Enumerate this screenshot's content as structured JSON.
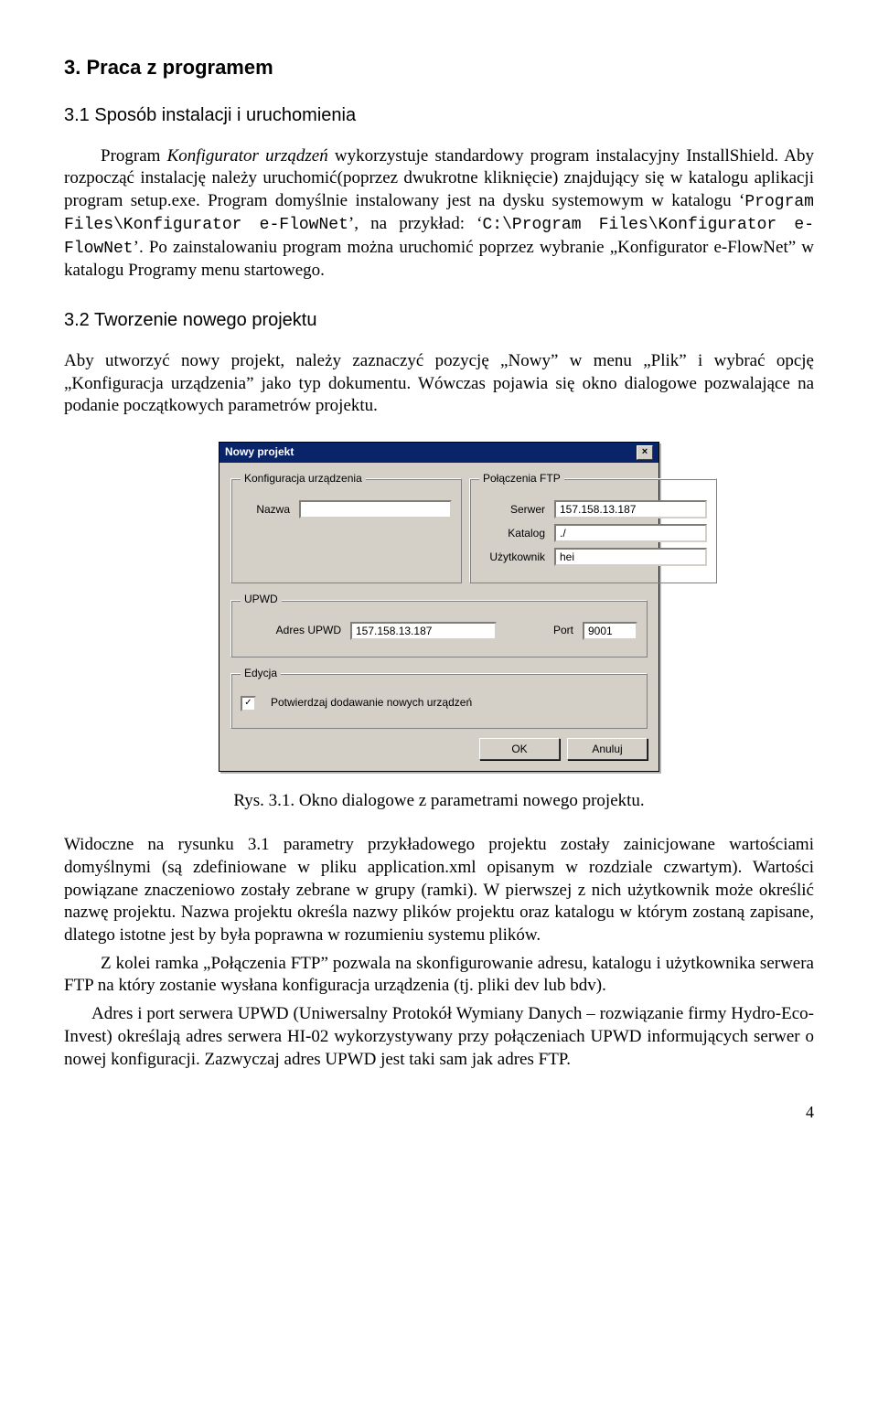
{
  "headings": {
    "h1": "3.  Praca z programem",
    "h2a": "3.1 Sposób instalacji i uruchomienia",
    "h2b": "3.2 Tworzenie nowego projektu"
  },
  "para": {
    "p1_a": "Program ",
    "p1_b": "Konfigurator urządzeń",
    "p1_c": " wykorzystuje standardowy program instalacyjny InstallShield. Aby rozpocząć instalację należy uruchomić(poprzez dwukrotne kliknięcie) znajdujący się w katalogu aplikacji program setup.exe. Program domyślnie instalowany jest na dysku systemowym w katalogu ‘",
    "p1_d": "Program Files\\Konfigurator e-FlowNet",
    "p1_e": "’, na przykład: ‘",
    "p1_f": "C:\\Program Files\\Konfigurator e-FlowNet",
    "p1_g": "’. Po zainstalowaniu program można uruchomić poprzez wybranie „Konfigurator e-FlowNet” w katalogu Programy menu startowego.",
    "p2": "Aby utworzyć nowy projekt, należy zaznaczyć pozycję „Nowy” w menu „Plik” i wybrać opcję „Konfiguracja urządzenia” jako typ dokumentu. Wówczas pojawia się okno dialogowe pozwalające na podanie początkowych parametrów projektu.",
    "caption": "Rys. 3.1. Okno dialogowe z parametrami nowego projektu.",
    "p3": "Widoczne na rysunku 3.1 parametry przykładowego projektu  zostały zainicjowane wartościami domyślnymi (są zdefiniowane w pliku application.xml opisanym w rozdziale czwartym). Wartości powiązane znaczeniowo zostały zebrane w grupy (ramki). W pierwszej z nich użytkownik może określić nazwę projektu. Nazwa projektu określa nazwy plików projektu oraz katalogu w którym zostaną zapisane, dlatego istotne jest by była poprawna w rozumieniu systemu plików.",
    "p4": "Z kolei ramka „Połączenia FTP” pozwala na skonfigurowanie adresu, katalogu i użytkownika serwera FTP na który zostanie wysłana konfiguracja urządzenia (tj. pliki dev lub bdv).",
    "p5": "Adres i port serwera UPWD (Uniwersalny Protokół Wymiany Danych – rozwiązanie firmy Hydro-Eco-Invest) określają adres serwera HI-02 wykorzystywany przy połączeniach UPWD informujących serwer o nowej konfiguracji. Zazwyczaj adres UPWD jest taki sam jak adres FTP."
  },
  "dialog": {
    "title": "Nowy projekt",
    "close_glyph": "×",
    "groups": {
      "config": {
        "legend": "Konfiguracja urządzenia",
        "name_label": "Nazwa",
        "name_value": ""
      },
      "ftp": {
        "legend": "Połączenia FTP",
        "server_label": "Serwer",
        "server_value": "157.158.13.187",
        "catalog_label": "Katalog",
        "catalog_value": "./",
        "user_label": "Użytkownik",
        "user_value": "hei"
      },
      "upwd": {
        "legend": "UPWD",
        "addr_label": "Adres UPWD",
        "addr_value": "157.158.13.187",
        "port_label": "Port",
        "port_value": "9001"
      },
      "edit": {
        "legend": "Edycja",
        "checkbox_label": "Potwierdzaj dodawanie nowych urządzeń",
        "checkbox_checked": "✓"
      }
    },
    "buttons": {
      "ok": "OK",
      "cancel": "Anuluj"
    }
  },
  "page_number": "4"
}
